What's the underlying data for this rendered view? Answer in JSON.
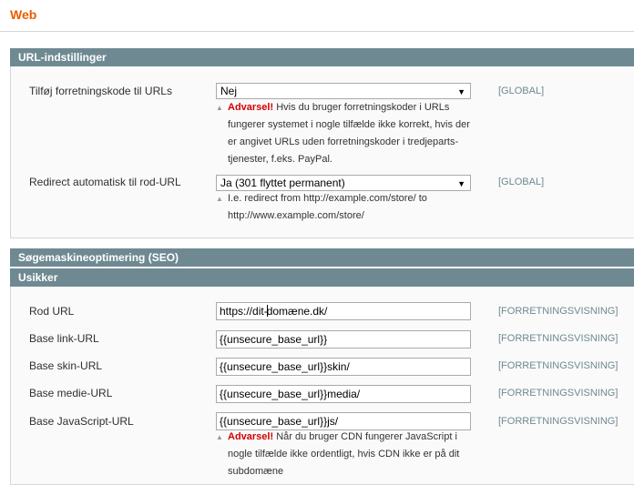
{
  "page": {
    "title": "Web"
  },
  "sections": {
    "url": {
      "header": "URL-indstillinger",
      "add_store_code": {
        "label": "Tilføj forretningskode til URLs",
        "value": "Nej",
        "scope": "[GLOBAL]",
        "note_warning": "Advarsel!",
        "note_text": " Hvis du bruger forretningskoder i URLs fungerer systemet i nogle tilfælde ikke korrekt, hvis der er angivet URLs uden forretningskoder i tredjeparts-tjenester, f.eks. PayPal."
      },
      "redirect": {
        "label": "Redirect automatisk til rod-URL",
        "value": "Ja (301 flyttet permanent)",
        "scope": "[GLOBAL]",
        "note_text": "I.e. redirect from http://example.com/store/ to http://www.example.com/store/"
      }
    },
    "seo": {
      "header": "Søgemaskineoptimering (SEO)"
    },
    "unsecure": {
      "header": "Usikker",
      "base_url": {
        "label": "Rod URL",
        "value_before_caret": "https://dit-",
        "value_after_caret": "domæne.dk/",
        "scope": "[FORRETNINGSVISNING]"
      },
      "base_link_url": {
        "label": "Base link-URL",
        "value": "{{unsecure_base_url}}",
        "scope": "[FORRETNINGSVISNING]"
      },
      "base_skin_url": {
        "label": "Base skin-URL",
        "value": "{{unsecure_base_url}}skin/",
        "scope": "[FORRETNINGSVISNING]"
      },
      "base_media_url": {
        "label": "Base medie-URL",
        "value": "{{unsecure_base_url}}media/",
        "scope": "[FORRETNINGSVISNING]"
      },
      "base_js_url": {
        "label": "Base JavaScript-URL",
        "value": "{{unsecure_base_url}}js/",
        "scope": "[FORRETNINGSVISNING]",
        "note_warning": "Advarsel!",
        "note_text": " Når du bruger CDN fungerer JavaScript i nogle tilfælde ikke ordentligt, hvis CDN ikke er på dit subdomæne"
      }
    }
  },
  "icons": {
    "dropdown": "chevron-down-icon",
    "note_marker": "triangle-up-icon"
  },
  "colors": {
    "title": "#eb5e00",
    "section_header": "#6f8992",
    "warning": "#d40000"
  }
}
